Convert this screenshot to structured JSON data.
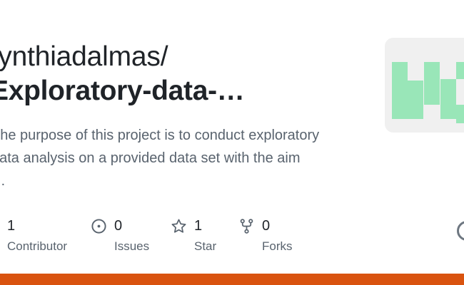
{
  "repo": {
    "owner": "cynthiadalmas/",
    "name": "Exploratory-data-…",
    "description_lines": [
      "The purpose of this project is to conduct exploratory",
      "data analysis on a provided data set with the aim",
      "…"
    ]
  },
  "stats": [
    {
      "value": "1",
      "label": "Contributor",
      "icon": "people-icon"
    },
    {
      "value": "0",
      "label": "Issues",
      "icon": "issue-opened-icon"
    },
    {
      "value": "1",
      "label": "Star",
      "icon": "star-icon"
    },
    {
      "value": "0",
      "label": "Forks",
      "icon": "repo-forked-icon"
    }
  ],
  "colors": {
    "accent_bar": "#d9530f",
    "identicon": "#99e6b8",
    "identicon_bg": "#f0f0f0"
  }
}
